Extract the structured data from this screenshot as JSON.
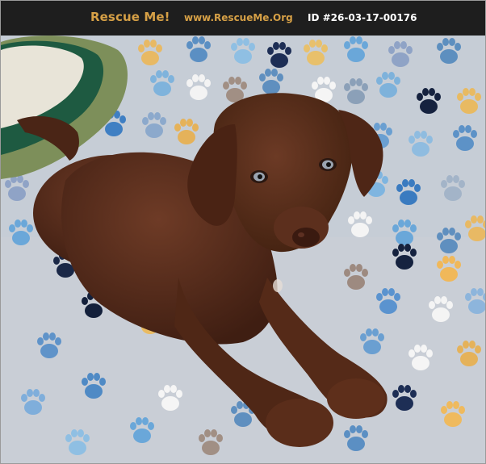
{
  "header": {
    "brand": "Rescue Me!",
    "site": "www.RescueMe.Org",
    "pet_id": "ID #26-03-17-00176"
  },
  "photo": {
    "subject": "puppy-photo"
  },
  "colors": {
    "header_bg": "#1e1e1e",
    "brand": "#d6a046",
    "id_text": "#ffffff"
  }
}
